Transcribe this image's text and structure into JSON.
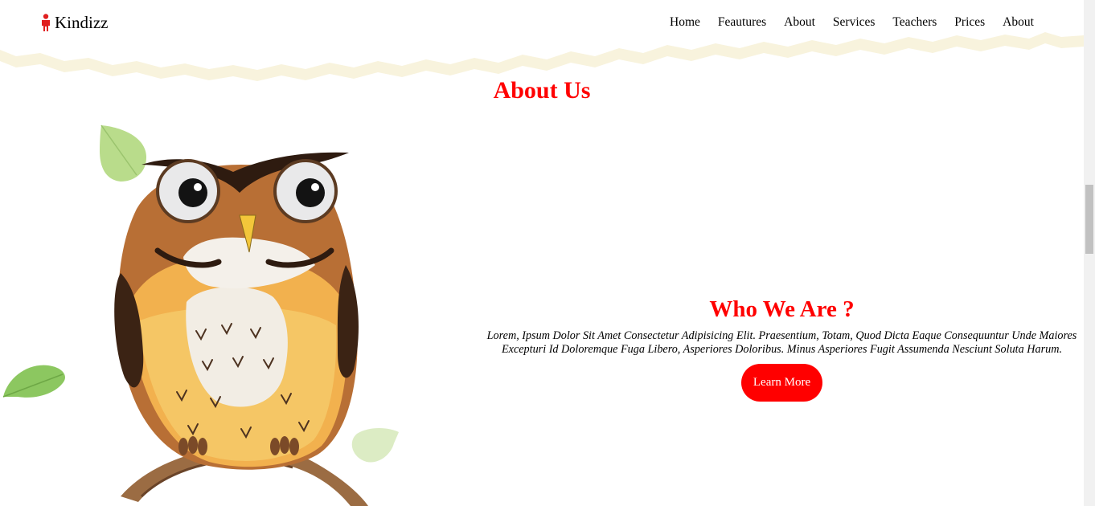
{
  "brand": {
    "name": "Kindizz",
    "icon": "person-icon"
  },
  "nav": {
    "items": [
      {
        "label": "Home"
      },
      {
        "label": "Feautures"
      },
      {
        "label": "About"
      },
      {
        "label": "Services"
      },
      {
        "label": "Teachers"
      },
      {
        "label": "Prices"
      },
      {
        "label": "About"
      }
    ]
  },
  "about": {
    "title": "About Us",
    "heading": "Who We Are ?",
    "body": "Lorem, Ipsum Dolor Sit Amet Consectetur Adipisicing Elit. Praesentium, Totam, Quod Dicta Eaque Consequuntur Unde Maiores Excepturi Id Doloremque Fuga Libero, Asperiores Doloribus. Minus Asperiores Fugit Assumenda Nesciunt Soluta Harum.",
    "button_label": "Learn More"
  },
  "colors": {
    "accent": "#ff0000",
    "text": "#000000",
    "paper": "#fbf8ec"
  }
}
